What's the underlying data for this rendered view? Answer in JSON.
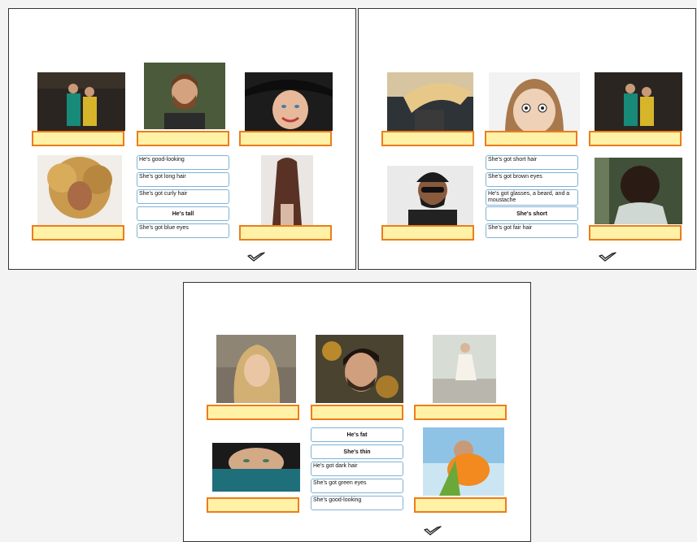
{
  "exercise_1": {
    "options": [
      "He's good-looking",
      "She's got long hair",
      "She's got curly hair",
      "He's tall",
      "She's got blue eyes"
    ],
    "photos": [
      "couple-in-traditional-dress-photo",
      "bearded-man-photo",
      "smiling-woman-in-hat-photo",
      "curly-haired-woman-photo",
      "long-haired-woman-back-photo"
    ]
  },
  "exercise_2": {
    "options": [
      "She's got short hair",
      "She's got brown eyes",
      "He's got glasses, a beard, and a moustache",
      "She's short",
      "She's got fair hair"
    ],
    "photos": [
      "blonde-woman-hair-blowing-photo",
      "surprised-girl-photo",
      "couple-in-traditional-dress-photo",
      "man-with-sunglasses-and-beard-photo",
      "curly-hair-woman-from-behind-photo"
    ]
  },
  "exercise_3": {
    "options": [
      "He's fat",
      "She's thin",
      "He's got dark hair",
      "She's got green eyes",
      "She's good-looking"
    ],
    "photos": [
      "smiling-blonde-woman-photo",
      "man-with-dark-hair-photo",
      "woman-in-white-dress-photo",
      "woman-with-green-eyes-photo",
      "man-with-pool-float-photo"
    ]
  },
  "icons": {
    "check": "checkmark-icon"
  },
  "colors": {
    "drop_fill": "#fff1a6",
    "drop_border": "#ec7d1c",
    "chip_border": "#7fb2d4"
  }
}
